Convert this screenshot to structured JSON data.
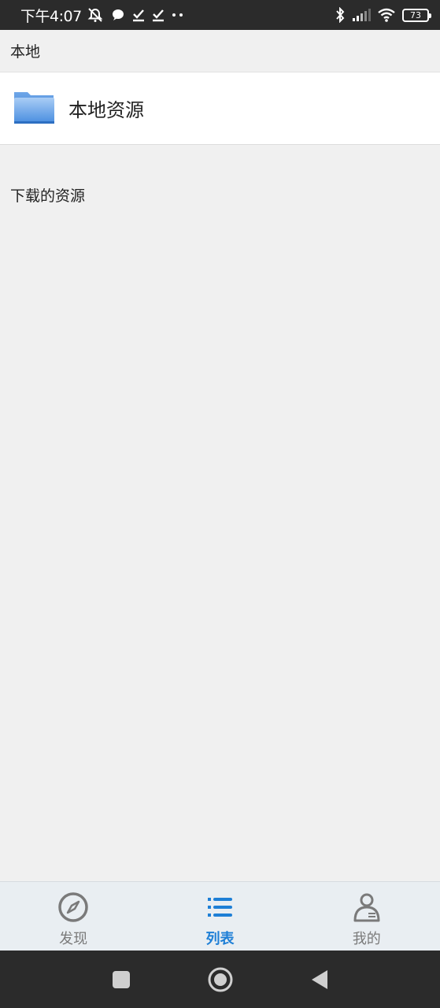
{
  "status_bar": {
    "time": "下午4:07",
    "battery_level": "73"
  },
  "local_section": {
    "title": "本地"
  },
  "local_folder": {
    "label": "本地资源",
    "icon": "folder-icon"
  },
  "downloads_section": {
    "title": "下载的资源"
  },
  "bottom_nav": {
    "items": [
      {
        "label": "发现",
        "icon": "compass-icon",
        "active": false
      },
      {
        "label": "列表",
        "icon": "list-icon",
        "active": true
      },
      {
        "label": "我的",
        "icon": "user-icon",
        "active": false
      }
    ]
  },
  "colors": {
    "accent": "#1e7fd6",
    "status_bar_bg": "#2b2b2b",
    "nav_bg": "#e9eef2"
  }
}
